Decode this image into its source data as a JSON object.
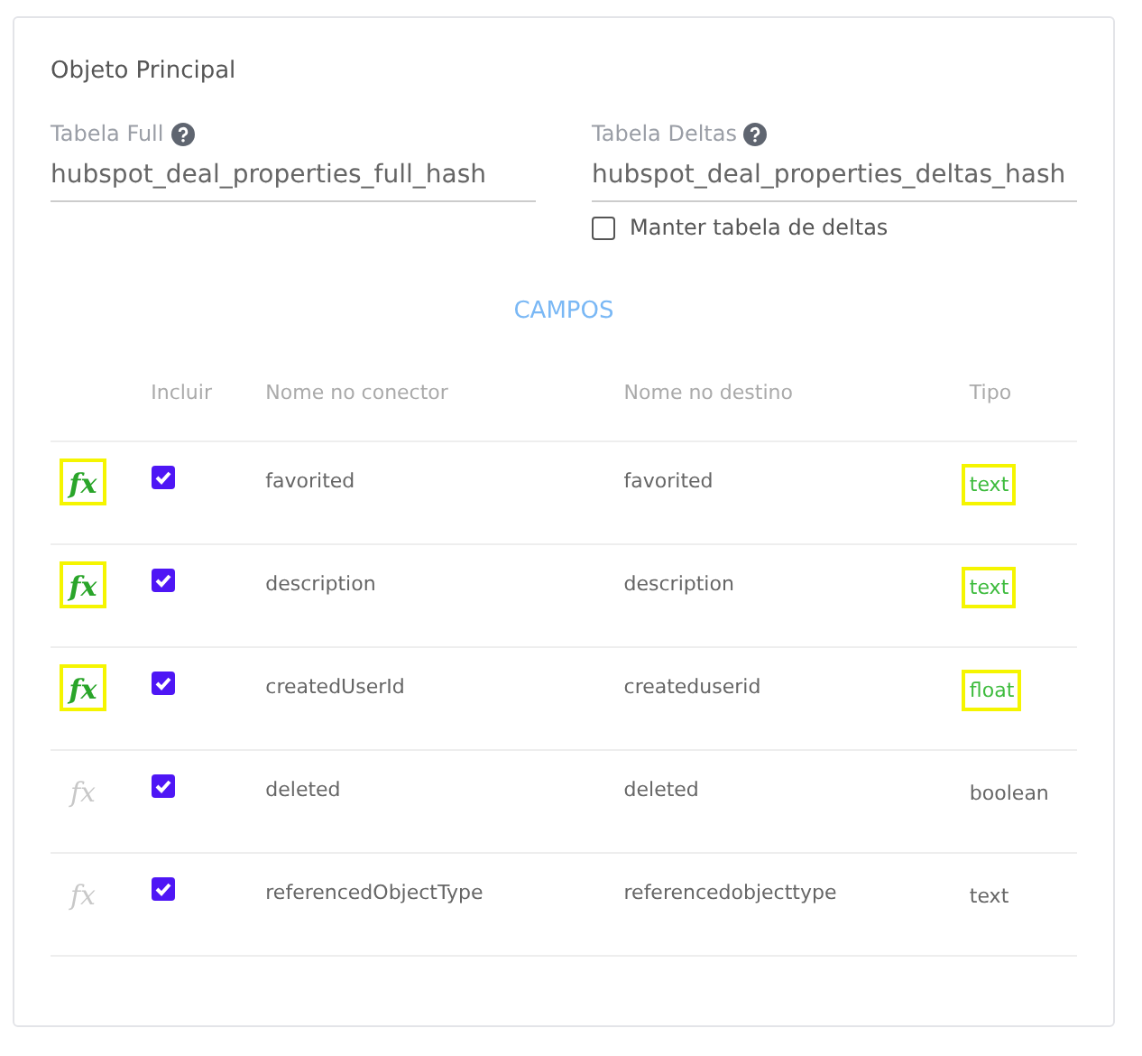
{
  "section": {
    "title": "Objeto Principal"
  },
  "fields": [
    {
      "label": "Tabela Full",
      "value": "hubspot_deal_properties_full_hash"
    },
    {
      "label": "Tabela Deltas",
      "value": "hubspot_deal_properties_deltas_hash"
    }
  ],
  "keep_deltas": {
    "label": "Manter tabela de deltas",
    "checked": false
  },
  "fields_heading": "CAMPOS",
  "table": {
    "columns": [
      "Incluir",
      "Nome no conector",
      "Nome no destino",
      "Tipo"
    ],
    "rows": [
      {
        "formula_icon": "fx",
        "formula": true,
        "included": true,
        "source": "favorited",
        "target": "favorited",
        "type": "text",
        "highlighted": true
      },
      {
        "formula_icon": "fx",
        "formula": true,
        "included": true,
        "source": "description",
        "target": "description",
        "type": "text",
        "highlighted": true
      },
      {
        "formula_icon": "fx",
        "formula": true,
        "included": true,
        "source": "createdUserId",
        "target": "createduserid",
        "type": "float",
        "highlighted": true
      },
      {
        "formula_icon": "fx",
        "formula": false,
        "included": true,
        "source": "deleted",
        "target": "deleted",
        "type": "boolean",
        "highlighted": false
      },
      {
        "formula_icon": "fx",
        "formula": false,
        "included": true,
        "source": "referencedObjectType",
        "target": "referencedobjecttype",
        "type": "text",
        "highlighted": false
      }
    ]
  }
}
